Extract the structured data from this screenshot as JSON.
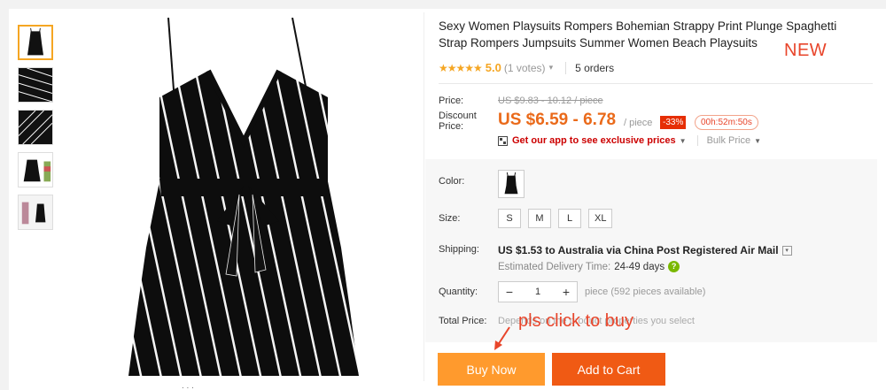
{
  "product": {
    "title": "Sexy Women Playsuits Rompers Bohemian Strappy Print Plunge Spaghetti Strap Rompers Jumpsuits Summer Women Beach Playsuits",
    "new_badge": "NEW",
    "stars": "★★★★★",
    "rating": "5.0",
    "votes": "(1 votes)",
    "orders": "5 orders"
  },
  "price": {
    "price_label": "Price:",
    "original": "US $9.83 - 10.12 / piece",
    "discount_label": "Discount Price:",
    "discount": "US $6.59 - 6.78",
    "per_piece": "/ piece",
    "off": "-33%",
    "timer": "00h:52m:50s",
    "app_link": "Get our app to see exclusive prices",
    "bulk": "Bulk Price"
  },
  "options": {
    "color_label": "Color:",
    "size_label": "Size:",
    "sizes": [
      "S",
      "M",
      "L",
      "XL"
    ]
  },
  "shipping": {
    "label": "Shipping:",
    "cost": "US $1.53",
    "to": "to Australia via China Post Registered Air Mail",
    "delivery_label": "Estimated Delivery Time:",
    "delivery_days": "24-49 days",
    "help_glyph": "?"
  },
  "quantity": {
    "label": "Quantity:",
    "value": "1",
    "minus": "−",
    "plus": "+",
    "available": "piece (592 pieces available)"
  },
  "total": {
    "label": "Total Price:",
    "note": "Depends on the product properties you select"
  },
  "annotation": "pls click to buy",
  "buttons": {
    "buy_now": "Buy Now",
    "add_to_cart": "Add to Cart"
  },
  "colors": {
    "accent_orange": "#ea6a1a",
    "buy_now_bg": "#ff9a2d",
    "add_to_cart_bg": "#f05a14",
    "rating_star": "#f5a623",
    "annotation_red": "#e8452b"
  }
}
